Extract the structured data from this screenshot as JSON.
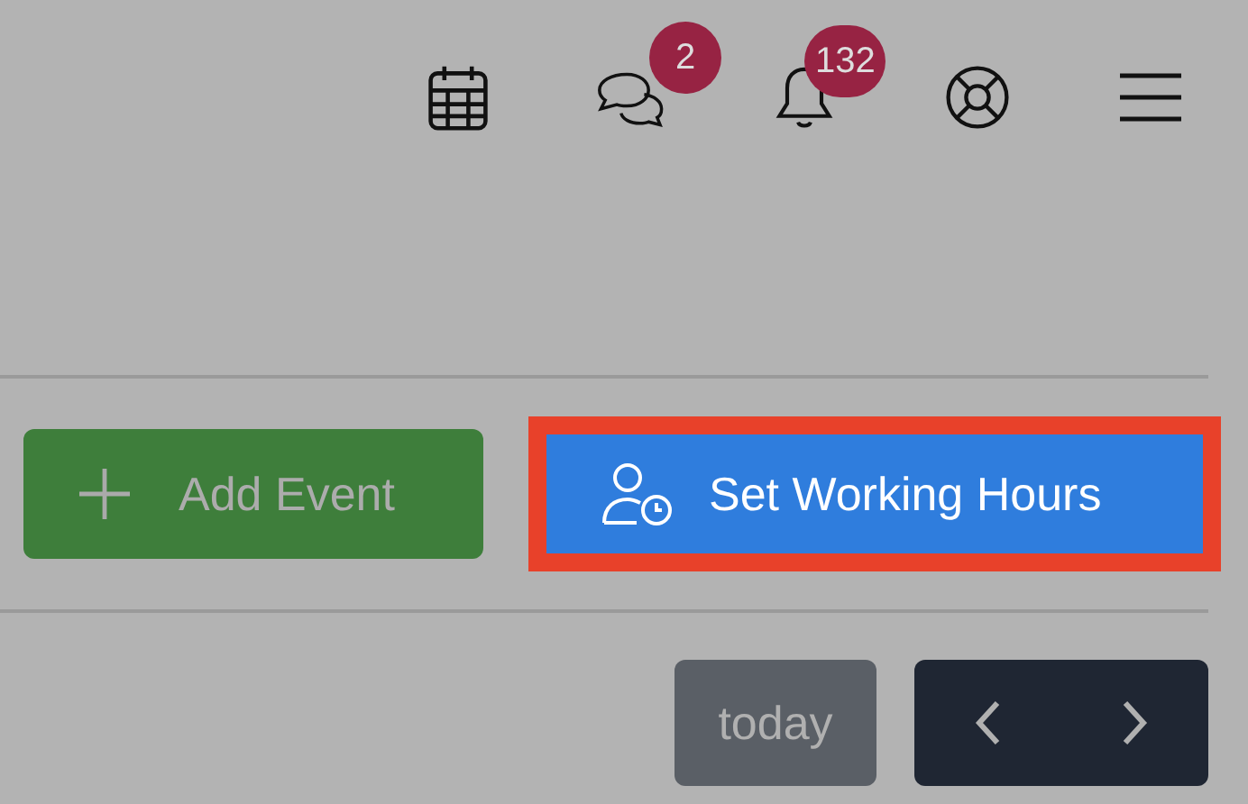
{
  "toolbar": [
    {
      "kind": "calendar"
    },
    {
      "kind": "chat",
      "badge": "2"
    },
    {
      "kind": "bell",
      "badge": "132"
    },
    {
      "kind": "help"
    },
    {
      "kind": "menu"
    }
  ],
  "actions": [
    {
      "kind": "add",
      "label": "Add Event",
      "highlighted": false
    },
    {
      "kind": "hours",
      "label": "Set Working Hours",
      "highlighted": true
    }
  ],
  "nav": {
    "today_label": "today"
  }
}
